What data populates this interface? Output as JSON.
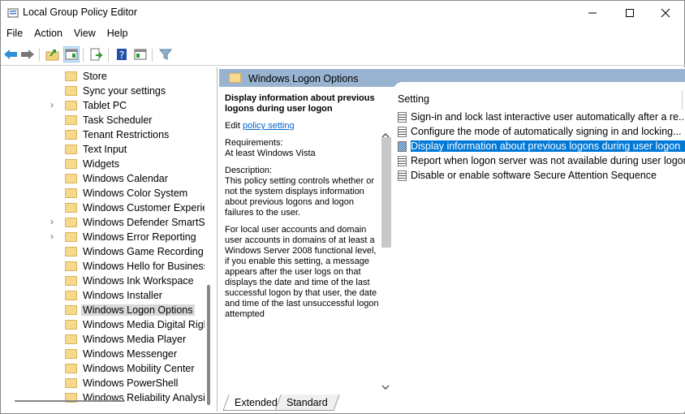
{
  "window": {
    "title": "Local Group Policy Editor",
    "controls": [
      "minimize",
      "maximize",
      "close"
    ]
  },
  "menu": [
    "File",
    "Action",
    "View",
    "Help"
  ],
  "toolbar": [
    "back-icon",
    "forward-icon",
    "up-folder-icon",
    "show-hide-tree-icon",
    "export-list-icon",
    "help-icon",
    "show-hide-action-pane-icon",
    "filter-icon"
  ],
  "tree": {
    "items": [
      {
        "label": "Store",
        "expandable": false
      },
      {
        "label": "Sync your settings",
        "expandable": false
      },
      {
        "label": "Tablet PC",
        "expandable": true
      },
      {
        "label": "Task Scheduler",
        "expandable": false
      },
      {
        "label": "Tenant Restrictions",
        "expandable": false
      },
      {
        "label": "Text Input",
        "expandable": false
      },
      {
        "label": "Widgets",
        "expandable": false
      },
      {
        "label": "Windows Calendar",
        "expandable": false
      },
      {
        "label": "Windows Color System",
        "expandable": false
      },
      {
        "label": "Windows Customer Experience Improvement Program",
        "expandable": false
      },
      {
        "label": "Windows Defender SmartScreen",
        "expandable": true
      },
      {
        "label": "Windows Error Reporting",
        "expandable": true
      },
      {
        "label": "Windows Game Recording and Broadcasting",
        "expandable": false
      },
      {
        "label": "Windows Hello for Business",
        "expandable": false
      },
      {
        "label": "Windows Ink Workspace",
        "expandable": false
      },
      {
        "label": "Windows Installer",
        "expandable": false
      },
      {
        "label": "Windows Logon Options",
        "expandable": false,
        "selected": true
      },
      {
        "label": "Windows Media Digital Rights Management",
        "expandable": false
      },
      {
        "label": "Windows Media Player",
        "expandable": false
      },
      {
        "label": "Windows Messenger",
        "expandable": false
      },
      {
        "label": "Windows Mobility Center",
        "expandable": false
      },
      {
        "label": "Windows PowerShell",
        "expandable": false
      },
      {
        "label": "Windows Reliability Analysis",
        "expandable": false
      }
    ]
  },
  "details": {
    "header": "Windows Logon Options",
    "description": {
      "title": "Display information about previous logons during user logon",
      "edit_prefix": "Edit ",
      "edit_link": "policy setting",
      "requirements_label": "Requirements:",
      "requirements": "At least Windows Vista",
      "description_label": "Description:",
      "para1": "This policy setting controls whether or not the system displays information about previous logons and logon failures to the user.",
      "para2": "For local user accounts and domain user accounts in domains of at least a Windows Server 2008 functional level, if you enable this setting, a message appears after the user logs on that displays the date and time of the last successful logon by that user, the date and time of the last unsuccessful logon attempted"
    },
    "list": {
      "column": "Setting",
      "rows": [
        {
          "label": "Sign-in and lock last interactive user automatically after a re..."
        },
        {
          "label": "Configure the mode of automatically signing in and locking..."
        },
        {
          "label": "Display information about previous logons during user logon",
          "selected": true
        },
        {
          "label": "Report when logon server was not available during user logon"
        },
        {
          "label": "Disable or enable software Secure Attention Sequence"
        }
      ]
    },
    "tabs": [
      "Extended",
      "Standard"
    ],
    "active_tab": "Extended"
  },
  "colors": {
    "selection": "#0078d7",
    "header_band": "#99b4d1",
    "tree_selection": "#d9d9d9"
  }
}
